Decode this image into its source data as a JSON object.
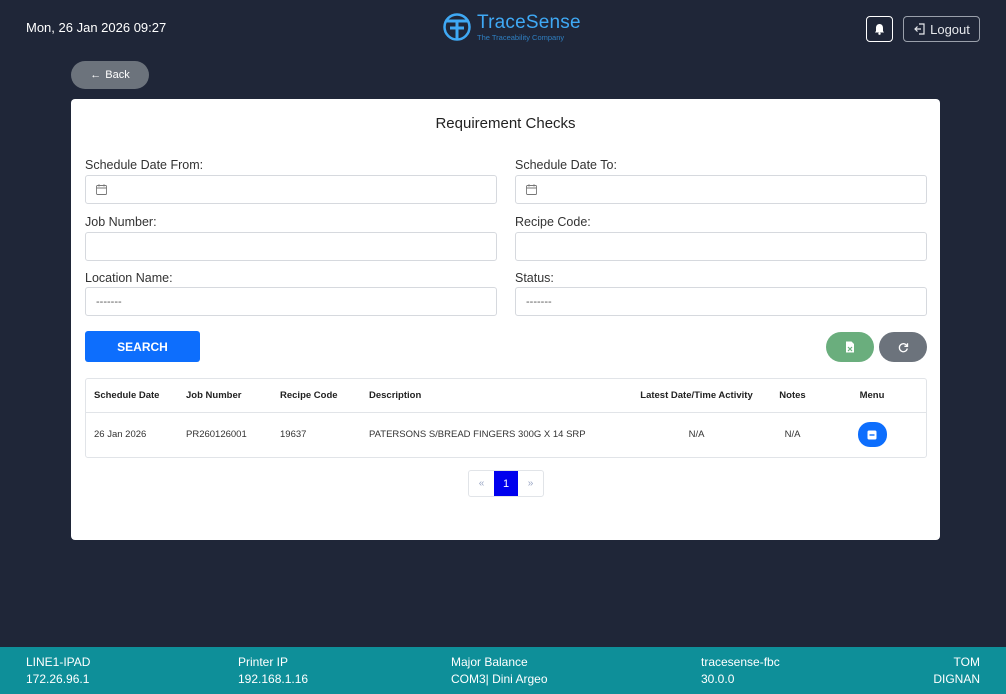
{
  "header": {
    "datetime": "Mon, 26 Jan 2026 09:27",
    "logo_name": "TraceSense",
    "logo_tagline": "The Traceability Company",
    "logout_label": "Logout"
  },
  "back_label": "Back",
  "page_title": "Requirement Checks",
  "form": {
    "schedule_from_label": "Schedule Date From:",
    "schedule_to_label": "Schedule Date To:",
    "job_number_label": "Job Number:",
    "job_number_value": "",
    "recipe_code_label": "Recipe Code:",
    "recipe_code_value": "",
    "location_label": "Location Name:",
    "location_value": "-------",
    "status_label": "Status:",
    "status_value": "-------"
  },
  "search_label": "SEARCH",
  "table": {
    "headers": [
      "Schedule Date",
      "Job Number",
      "Recipe Code",
      "Description",
      "Latest Date/Time Activity",
      "Notes",
      "Menu"
    ],
    "rows": [
      {
        "schedule_date": "26 Jan 2026",
        "job_number": "PR260126001",
        "recipe_code": "19637",
        "description": "PATERSONS S/BREAD FINGERS 300G X 14 SRP",
        "latest_activity": "N/A",
        "notes": "N/A"
      }
    ]
  },
  "pagination": {
    "prev": "«",
    "current": "1",
    "next": "»"
  },
  "footer": {
    "device_name": "LINE1-IPAD",
    "device_ip": "172.26.96.1",
    "printer_label": "Printer IP",
    "printer_ip": "192.168.1.16",
    "balance_label": "Major Balance",
    "balance_value": "COM3| Dini Argeo",
    "app_name": "tracesense-fbc",
    "app_version": "30.0.0",
    "user_first": "TOM",
    "user_last": "DIGNAN"
  },
  "colors": {
    "background": "#1f2638",
    "primary": "#0d6efd",
    "footer": "#0e8f99",
    "export": "#6aae7d",
    "secondary": "#6c737c",
    "brand": "#3fa9f5"
  },
  "icons": [
    "tracesense-logo-icon",
    "bell-icon",
    "logout-icon",
    "back-arrow-icon",
    "calendar-icon",
    "export-excel-icon",
    "refresh-icon",
    "menu-icon"
  ]
}
